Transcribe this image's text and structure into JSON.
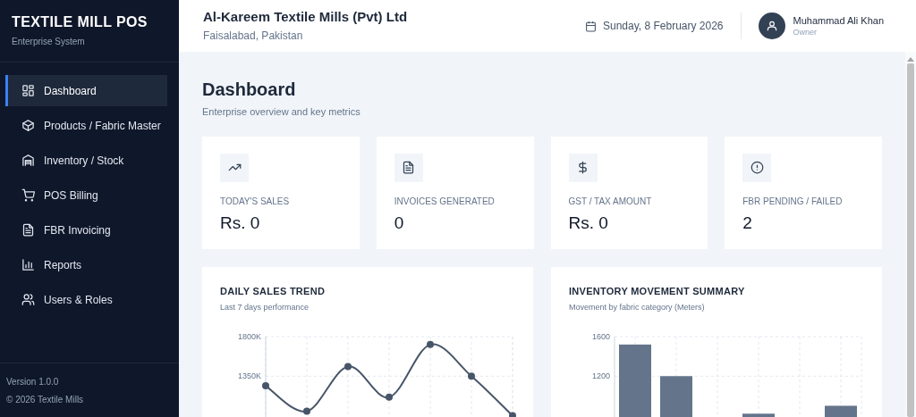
{
  "sidebar": {
    "brand": "TEXTILE MILL POS",
    "subtitle": "Enterprise System",
    "items": [
      {
        "label": "Dashboard",
        "selected": true
      },
      {
        "label": "Products / Fabric Master",
        "selected": false
      },
      {
        "label": "Inventory / Stock",
        "selected": false
      },
      {
        "label": "POS Billing",
        "selected": false
      },
      {
        "label": "FBR Invoicing",
        "selected": false
      },
      {
        "label": "Reports",
        "selected": false
      },
      {
        "label": "Users & Roles",
        "selected": false
      }
    ],
    "version": "Version 1.0.0",
    "copyright": "© 2026 Textile Mills"
  },
  "header": {
    "company": "Al-Kareem Textile Mills (Pvt) Ltd",
    "location": "Faisalabad, Pakistan",
    "date": "Sunday, 8 February 2026",
    "user_name": "Muhammad Ali Khan",
    "user_role": "Owner"
  },
  "page": {
    "title": "Dashboard",
    "subtitle": "Enterprise overview and key metrics"
  },
  "stats": [
    {
      "label": "TODAY'S SALES",
      "value": "Rs. 0"
    },
    {
      "label": "INVOICES GENERATED",
      "value": "0"
    },
    {
      "label": "GST / TAX AMOUNT",
      "value": "Rs. 0"
    },
    {
      "label": "FBR PENDING / FAILED",
      "value": "2"
    }
  ],
  "charts": [
    {
      "title": "DAILY SALES TREND",
      "subtitle": "Last 7 days performance",
      "chart_data": {
        "type": "line",
        "grid": true,
        "ylim": [
          0,
          1800
        ],
        "yticks": [
          {
            "value": 1800,
            "label": "1800K"
          },
          {
            "value": 1350,
            "label": "1350K"
          }
        ],
        "series": [
          {
            "color": "#475569",
            "marker": true,
            "values": [
              1240,
              950,
              1460,
              1110,
              1710,
              1350,
              900
            ]
          }
        ]
      }
    },
    {
      "title": "INVENTORY MOVEMENT SUMMARY",
      "subtitle": "Movement by fabric category (Meters)",
      "chart_data": {
        "type": "bar",
        "grid": true,
        "ylim": [
          0,
          1600
        ],
        "yticks": [
          {
            "value": 1600,
            "label": "1600"
          },
          {
            "value": 1200,
            "label": "1200"
          }
        ],
        "series": [
          {
            "color": "#64748b",
            "values": [
              1520,
              1200,
              null,
              820,
              null,
              900
            ]
          }
        ]
      }
    }
  ]
}
